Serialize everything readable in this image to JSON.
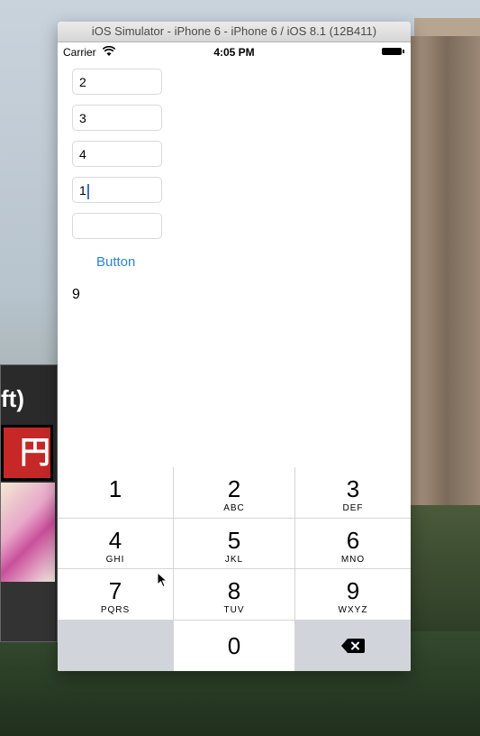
{
  "simulator": {
    "title": "iOS Simulator - iPhone 6 - iPhone 6 / iOS 8.1 (12B411)"
  },
  "status_bar": {
    "carrier": "Carrier",
    "time": "4:05 PM",
    "icons": [
      "wifi-icon",
      "battery-icon"
    ]
  },
  "fields": [
    {
      "value": "2"
    },
    {
      "value": "3"
    },
    {
      "value": "4"
    },
    {
      "value": "1"
    },
    {
      "value": ""
    }
  ],
  "button": {
    "label": "Button"
  },
  "result": {
    "value": "9"
  },
  "keypad": {
    "keys": [
      {
        "digit": "1",
        "letters": ""
      },
      {
        "digit": "2",
        "letters": "ABC"
      },
      {
        "digit": "3",
        "letters": "DEF"
      },
      {
        "digit": "4",
        "letters": "GHI"
      },
      {
        "digit": "5",
        "letters": "JKL"
      },
      {
        "digit": "6",
        "letters": "MNO"
      },
      {
        "digit": "7",
        "letters": "PQRS"
      },
      {
        "digit": "8",
        "letters": "TUV"
      },
      {
        "digit": "9",
        "letters": "WXYZ"
      },
      {
        "digit": "0",
        "letters": ""
      }
    ]
  },
  "background_window": {
    "text": "ft)",
    "sign": "円"
  }
}
